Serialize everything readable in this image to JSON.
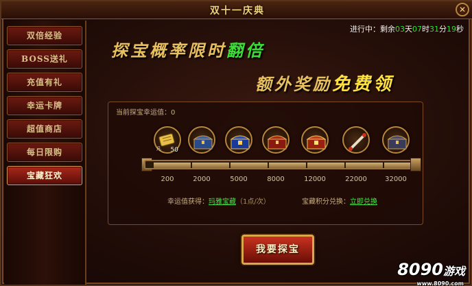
{
  "window": {
    "title": "双十一庆典",
    "close_label": "✕"
  },
  "countdown": {
    "prefix": "进行中：剩余",
    "days": "03",
    "day_unit": "天",
    "hours": "07",
    "hour_unit": "时",
    "minutes": "31",
    "minute_unit": "分",
    "seconds": "19",
    "second_unit": "秒"
  },
  "sidebar": {
    "items": [
      {
        "label": "双倍经验"
      },
      {
        "label": "BOSS送礼"
      },
      {
        "label": "充值有礼"
      },
      {
        "label": "幸运卡牌"
      },
      {
        "label": "超值商店"
      },
      {
        "label": "每日限购"
      },
      {
        "label": "宝藏狂欢"
      }
    ],
    "active_index": 6
  },
  "banner": {
    "line1_prefix": "探宝概率限时",
    "line1_highlight": "翻倍",
    "line2_prefix": "额外奖励",
    "line2_highlight": "免费领"
  },
  "panel": {
    "luck_label": "当前探宝幸运值：",
    "luck_value": "0",
    "rewards": [
      {
        "icon": "gold-scroll-icon",
        "qty": "50",
        "tag": "凡",
        "threshold": "200"
      },
      {
        "icon": "blue-chest-icon",
        "threshold": "2000"
      },
      {
        "icon": "blue-gold-chest-icon",
        "threshold": "5000"
      },
      {
        "icon": "red-chest-icon",
        "threshold": "8000"
      },
      {
        "icon": "red-gold-chest-icon",
        "threshold": "12000"
      },
      {
        "icon": "bone-staff-icon",
        "threshold": "22000"
      },
      {
        "icon": "dark-chest-icon",
        "threshold": "32000"
      }
    ],
    "progress": 0
  },
  "info": {
    "luck_get_label": "幸运值获得：",
    "luck_get_link": "玛雅宝藏",
    "luck_get_note": "（1点/次）",
    "exchange_label": "宝藏积分兑换：",
    "exchange_link": "立即兑换"
  },
  "action": {
    "treasure_button": "我要探宝"
  },
  "watermark": {
    "brand": "8090",
    "suffix": "游戏",
    "url": "www.8090.com"
  },
  "colors": {
    "accent_gold": "#e8c060",
    "highlight_green": "#3edc3a",
    "button_red": "#c83220"
  }
}
